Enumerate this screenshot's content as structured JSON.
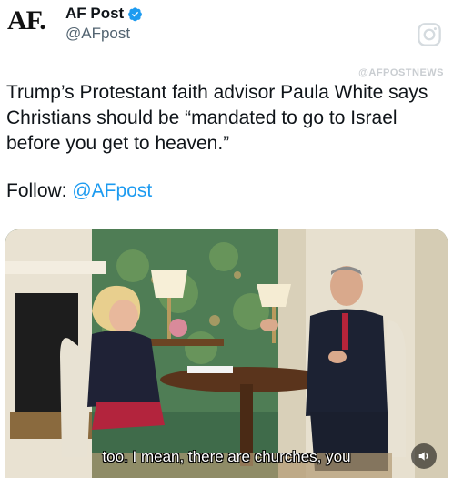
{
  "account": {
    "logo_text": "AF",
    "display_name": "AF Post",
    "handle": "@AFpost",
    "verified": true
  },
  "tweet": {
    "text": "Trump’s Protestant faith advisor Paula White says Christians should be “mandated to go to Israel before you get to heaven.”",
    "follow_prefix": "Follow: ",
    "follow_link": "@AFpost"
  },
  "media": {
    "watermark": "@AFPOSTNEWS",
    "caption": "too. I mean, there are churches, you",
    "icons": [
      "instagram-icon",
      "speaker-icon"
    ]
  },
  "colors": {
    "link": "#1d9bf0",
    "verified_badge": "#1d9bf0"
  }
}
